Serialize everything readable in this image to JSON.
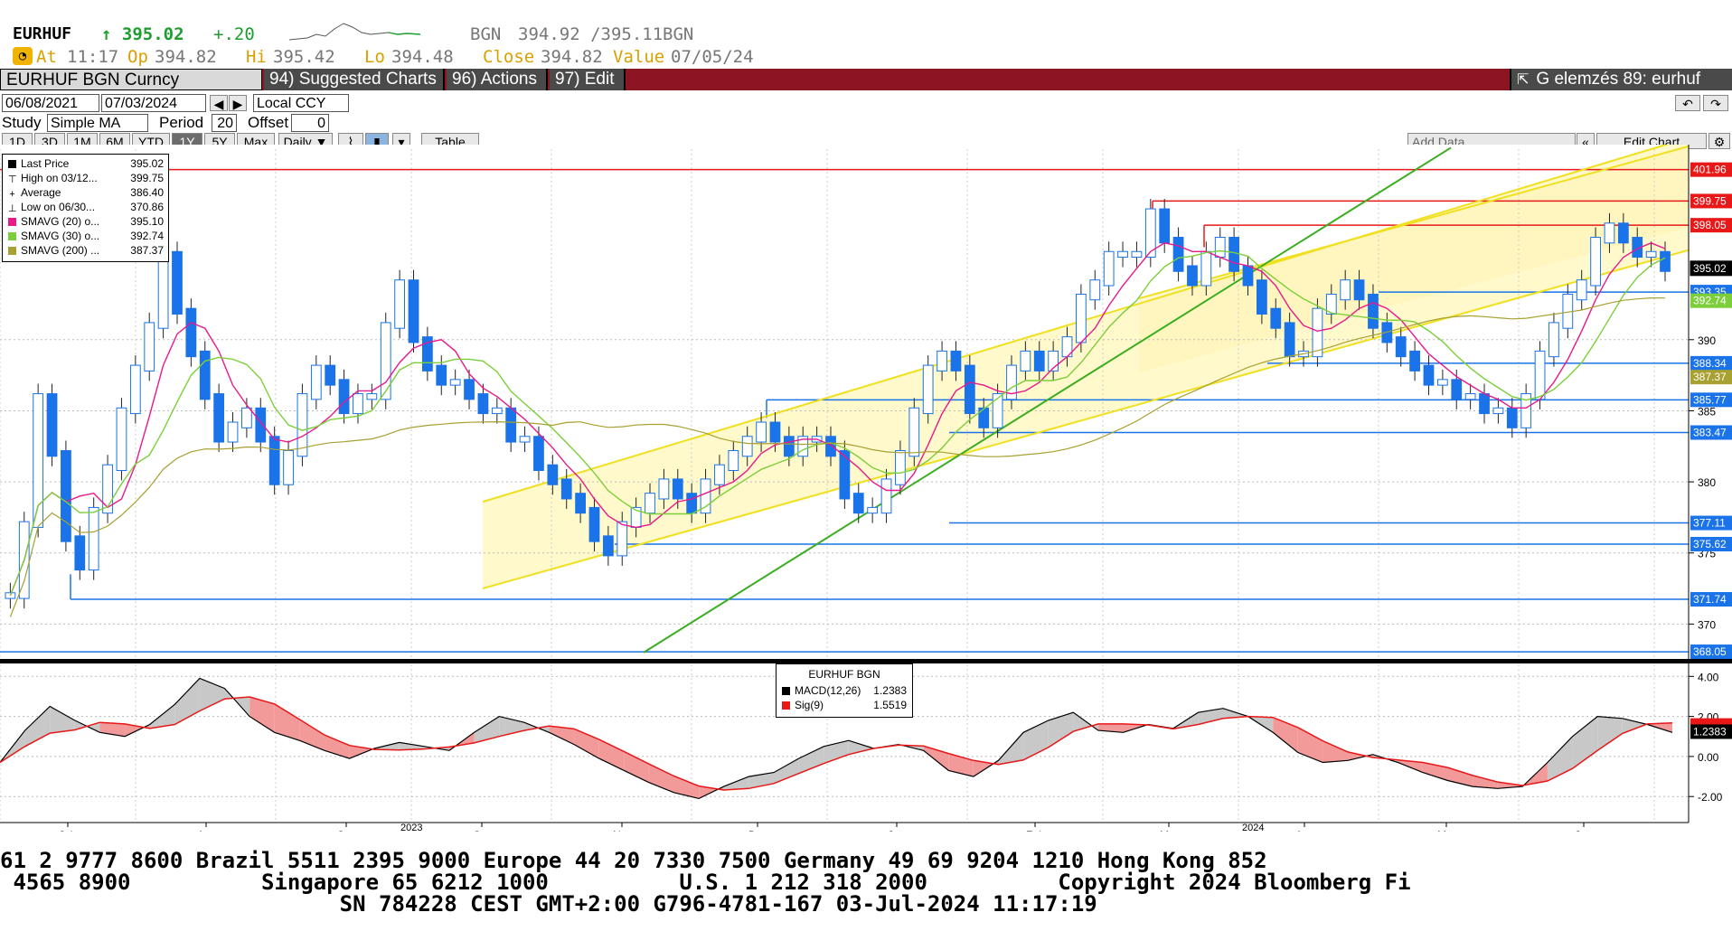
{
  "header": {
    "ticker": "EURHUF",
    "last": "↑ 395.02",
    "change": "+.20",
    "bid_label": "BGN",
    "bidask": "394.92 /395.11",
    "ask_label": "BGN",
    "at_label": "At",
    "time": "11:17",
    "op_label": "Op",
    "op": "394.82",
    "hi_label": "Hi",
    "hi": "395.42",
    "lo_label": "Lo",
    "lo": "394.48",
    "close_label": "Close",
    "close": "394.82",
    "value_label": "Value",
    "value": "07/05/24"
  },
  "menubar": {
    "security": "EURHUF BGN Curncy",
    "suggested": "94) Suggested Charts ▾",
    "actions": "96) Actions ▾",
    "edit": "97) Edit ▾",
    "right_title": "G elemzés 89: eurhuf"
  },
  "controls": {
    "date_from": "06/08/2021",
    "date_to": "07/03/2024",
    "ccy": "Local CCY",
    "study_label": "Study",
    "study": "Simple MA",
    "period_label": "Period",
    "period": "20",
    "offset_label": "Offset",
    "offset": "0",
    "ranges": [
      "1D",
      "3D",
      "1M",
      "6M",
      "YTD",
      "1Y",
      "5Y",
      "Max"
    ],
    "frequency": "Daily ▼",
    "table": "Table",
    "add_data": "Add Data",
    "edit_chart": "Edit Chart"
  },
  "legend": [
    {
      "label": "Last Price",
      "value": "395.02",
      "color": "#000000"
    },
    {
      "label": "High on 03/12...",
      "value": "399.75",
      "color": ""
    },
    {
      "label": "Average",
      "value": "386.40",
      "color": ""
    },
    {
      "label": "Low on 06/30...",
      "value": "370.86",
      "color": ""
    },
    {
      "label": "SMAVG (20)  o...",
      "value": "395.10",
      "color": "#e8198b"
    },
    {
      "label": "SMAVG (30)  o...",
      "value": "392.74",
      "color": "#7ccf3a"
    },
    {
      "label": "SMAVG (200)  ...",
      "value": "387.37",
      "color": "#a8a030"
    }
  ],
  "macd_legend": {
    "title": "EURHUF BGN",
    "rows": [
      {
        "label": "MACD(12,26)",
        "value": "1.2383",
        "color": "#000000"
      },
      {
        "label": "Sig(9)",
        "value": "1.5519",
        "color": "#e81818"
      }
    ]
  },
  "chart_data": [
    {
      "type": "candlestick",
      "y_ticks": [
        370,
        375,
        380,
        385,
        390
      ],
      "ylim": [
        367.8,
        403.4
      ],
      "price_labels": [
        {
          "text": "401.96",
          "value": 401.96,
          "color": "#e81818"
        },
        {
          "text": "399.75",
          "value": 399.75,
          "color": "#e81818"
        },
        {
          "text": "398.05",
          "value": 398.05,
          "color": "#e81818"
        },
        {
          "text": "395.02",
          "value": 395.02,
          "color": "#000000"
        },
        {
          "text": "393.35",
          "value": 393.35,
          "color": "#1a73e8"
        },
        {
          "text": "392.74",
          "value": 392.74,
          "color": "#7ccf3a"
        },
        {
          "text": "388.34",
          "value": 388.34,
          "color": "#1a73e8"
        },
        {
          "text": "387.37",
          "value": 387.37,
          "color": "#a8a030"
        },
        {
          "text": "385.77",
          "value": 385.77,
          "color": "#1a73e8"
        },
        {
          "text": "383.47",
          "value": 383.47,
          "color": "#1a73e8"
        },
        {
          "text": "377.11",
          "value": 377.11,
          "color": "#1a73e8"
        },
        {
          "text": "375.62",
          "value": 375.62,
          "color": "#1a73e8"
        },
        {
          "text": "371.74",
          "value": 371.74,
          "color": "#1a73e8"
        },
        {
          "text": "368.05",
          "value": 368.05,
          "color": "#1a73e8"
        }
      ],
      "horizontal_levels": [
        401.96,
        399.75,
        398.05,
        393.35,
        388.34,
        385.77,
        383.47,
        377.11,
        375.62,
        371.74,
        368.05
      ],
      "x_labels": [
        "Jul",
        "Aug",
        "Sep",
        "Oct",
        "Nov",
        "Dec",
        "Jan",
        "Feb",
        "Mar",
        "Apr",
        "May",
        "Jun"
      ],
      "year_labels": [
        "2023",
        "2024"
      ],
      "close_series": [
        372,
        377,
        386,
        382,
        376,
        374,
        378,
        381,
        385,
        388,
        391,
        396,
        392,
        389,
        386,
        383,
        384,
        385,
        383,
        380,
        382,
        386,
        388,
        387,
        385,
        386,
        386,
        391,
        394,
        390,
        388,
        387,
        387,
        386,
        385,
        385,
        383,
        383,
        381,
        380,
        379,
        378,
        376,
        375,
        377,
        378,
        379,
        380,
        379,
        378,
        380,
        381,
        382,
        383,
        384,
        383,
        382,
        383,
        383,
        382,
        379,
        378,
        378,
        380,
        382,
        385,
        388,
        389,
        388,
        385,
        384,
        386,
        388,
        389,
        388,
        389,
        390,
        393,
        394,
        396,
        396,
        396,
        399,
        397,
        395,
        394,
        396,
        397,
        395,
        394,
        392,
        391,
        389,
        389,
        392,
        393,
        394,
        393,
        391,
        390,
        389,
        388,
        387,
        387,
        386,
        386,
        385,
        385,
        384,
        386,
        389,
        391,
        393,
        394,
        397,
        398,
        397,
        396,
        396,
        395
      ]
    },
    {
      "type": "line",
      "series": [
        {
          "name": "MACD(12,26)",
          "color": "#000000"
        },
        {
          "name": "Sig(9)",
          "color": "#e81818"
        }
      ],
      "y_ticks": [
        -2.0,
        0.0,
        2.0,
        4.0
      ],
      "y_tick_labels": [
        "-2.00",
        "0.00",
        "2.00",
        "4.00"
      ],
      "ylim": [
        -3.3,
        4.6
      ],
      "macd_label": "1.2383",
      "sig_label": "1.5519",
      "macd_series": [
        -0.3,
        1.3,
        2.5,
        1.8,
        1.2,
        1.0,
        1.6,
        2.6,
        3.9,
        3.4,
        2.0,
        1.2,
        0.8,
        0.3,
        -0.1,
        0.4,
        0.7,
        0.5,
        0.3,
        1.2,
        2.0,
        1.7,
        1.2,
        0.6,
        -0.1,
        -0.7,
        -1.3,
        -1.8,
        -2.1,
        -1.5,
        -1.0,
        -0.8,
        -0.1,
        0.5,
        0.8,
        0.4,
        0.6,
        0.3,
        -0.7,
        -1.0,
        -0.2,
        1.2,
        1.8,
        2.2,
        1.3,
        1.2,
        1.6,
        1.4,
        2.2,
        2.4,
        2.0,
        1.2,
        0.2,
        -0.3,
        -0.2,
        0.1,
        -0.3,
        -0.8,
        -1.2,
        -1.5,
        -1.6,
        -1.5,
        -0.3,
        1.0,
        2.0,
        1.9,
        1.6,
        1.2
      ]
    }
  ],
  "footer": {
    "line1": "61 2 9777 8600 Brazil 5511 2395 9000 Europe 44 20 7330 7500 Germany 49 69 9204 1210 Hong Kong 852",
    "line2": " 4565 8900          Singapore 65 6212 1000          U.S. 1 212 318 2000          Copyright 2024 Bloomberg Fi",
    "line3": "                          SN 784228 CEST GMT+2:00 G796-4781-167 03-Jul-2024 11:17:19"
  }
}
